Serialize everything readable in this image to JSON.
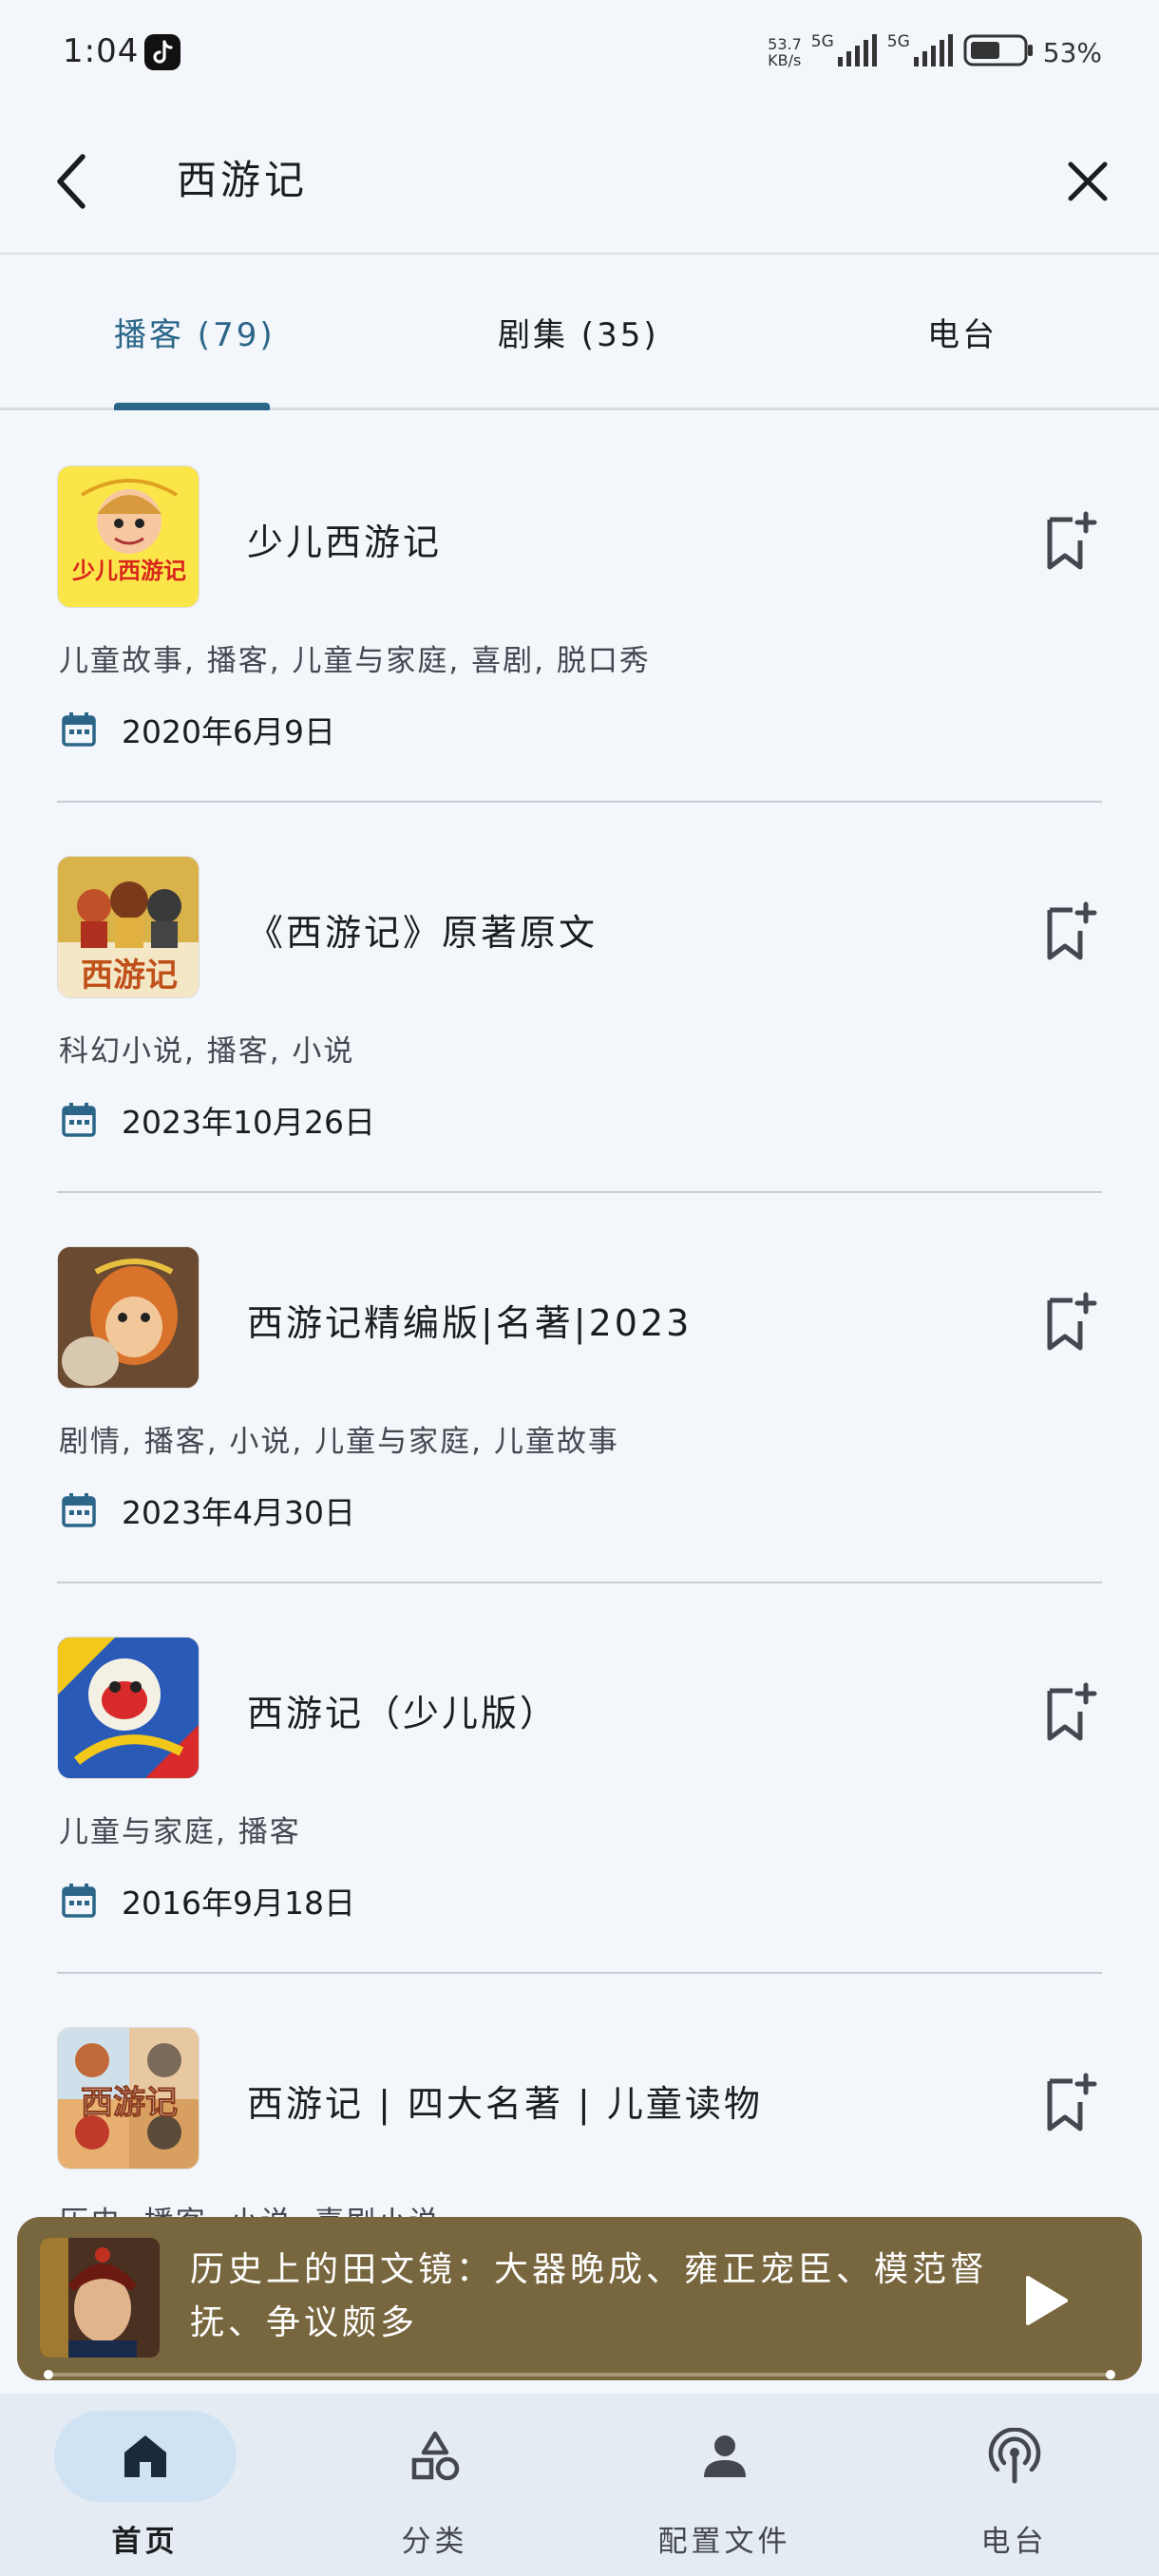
{
  "status_bar": {
    "time": "1:04",
    "net_speed": "53.7",
    "net_speed_unit": "KB/s",
    "signal_1": "5G",
    "signal_2": "5G",
    "battery": "53%"
  },
  "header": {
    "title": "西游记",
    "back_icon": "back-arrow-icon",
    "close_icon": "close-icon"
  },
  "tabs": [
    {
      "label": "播客 (79)",
      "active": true
    },
    {
      "label": "剧集 (35)",
      "active": false
    },
    {
      "label": "电台",
      "active": false
    }
  ],
  "results": [
    {
      "title": "少儿西游记",
      "tags": "儿童故事, 播客, 儿童与家庭, 喜剧, 脱口秀",
      "date": "2020年6月9日",
      "thumb_text": "少儿西游记"
    },
    {
      "title": "《西游记》原著原文",
      "tags": "科幻小说, 播客, 小说",
      "date": "2023年10月26日",
      "thumb_text": "西游记"
    },
    {
      "title": "西游记精编版|名著|2023",
      "tags": "剧情, 播客, 小说, 儿童与家庭, 儿童故事",
      "date": "2023年4月30日",
      "thumb_text": ""
    },
    {
      "title": "西游记（少儿版）",
      "tags": "儿童与家庭, 播客",
      "date": "2016年9月18日",
      "thumb_text": ""
    },
    {
      "title": "西游记 | 四大名著 | 儿童读物",
      "tags": "历史, 播客, 小说, 喜剧小说",
      "date": "",
      "thumb_text": "西游记"
    }
  ],
  "now_playing": {
    "title": "历史上的田文镜：大器晚成、雍正宠臣、模范督抚、争议颇多",
    "play_icon": "play-icon"
  },
  "bottom_nav": [
    {
      "label": "首页",
      "icon": "home-icon",
      "active": true
    },
    {
      "label": "分类",
      "icon": "categories-icon",
      "active": false
    },
    {
      "label": "配置文件",
      "icon": "profile-icon",
      "active": false
    },
    {
      "label": "电台",
      "icon": "radio-icon",
      "active": false
    }
  ],
  "colors": {
    "accent": "#2b6688",
    "background": "#f3f6fb",
    "player_bg": "#78663e",
    "nav_bg": "#e4ebf3",
    "nav_active_pill": "#cfe3f4"
  }
}
